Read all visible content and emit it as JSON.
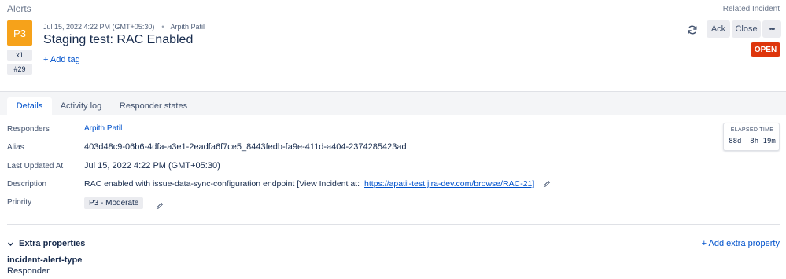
{
  "header": {
    "section_label": "Alerts",
    "related_incident_label": "Related Incident"
  },
  "alert": {
    "priority_badge": "P3",
    "count": "x1",
    "tiny_id": "#29",
    "created_at": "Jul 15, 2022 4:22 PM (GMT+05:30)",
    "separator": "•",
    "owner": "Arpith Patil",
    "title": "Staging test: RAC Enabled",
    "add_tag_label": "+ Add tag",
    "status": "OPEN",
    "priority_color": "#f6a21a",
    "status_color": "#de350b"
  },
  "actions": {
    "refresh_icon": "refresh-icon",
    "ack_label": "Ack",
    "close_label": "Close",
    "more_label": "•••"
  },
  "tabs": [
    {
      "label": "Details",
      "active": true
    },
    {
      "label": "Activity log",
      "active": false
    },
    {
      "label": "Responder states",
      "active": false
    }
  ],
  "details": {
    "responders_label": "Responders",
    "responders_value": "Arpith Patil",
    "alias_label": "Alias",
    "alias_value": "403d48c9-06b6-4dfa-a3e1-2eadfa6f7ce5_8443fedb-fa9e-411d-a404-2374285423ad",
    "updated_label": "Last Updated At",
    "updated_value": "Jul 15, 2022 4:22 PM (GMT+05:30)",
    "description_label": "Description",
    "description_text": "RAC enabled with issue-data-sync-configuration endpoint [View Incident at:",
    "description_link": "https://apatil-test.jira-dev.com/browse/RAC-21]",
    "priority_label": "Priority",
    "priority_value": "P3 - Moderate"
  },
  "elapsed": {
    "title": "ELAPSED TIME",
    "value": "88d  8h 19m"
  },
  "extra": {
    "header": "Extra properties",
    "add_label": "+ Add extra property",
    "properties": [
      {
        "key": "incident-alert-type",
        "value": "Responder"
      }
    ]
  },
  "colors": {
    "link": "#0052cc",
    "tab_band": "#f4f5f7"
  }
}
